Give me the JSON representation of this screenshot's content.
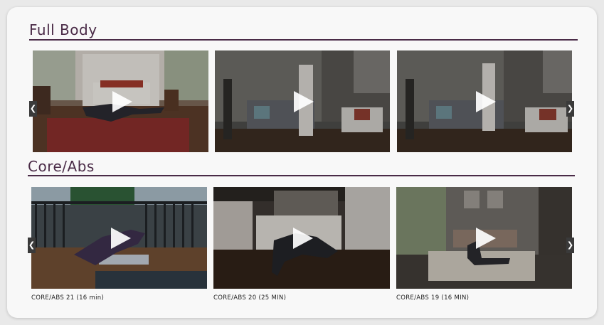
{
  "sections": [
    {
      "title": "Full Body",
      "videos": [
        {
          "caption": ""
        },
        {
          "caption": ""
        },
        {
          "caption": ""
        }
      ]
    },
    {
      "title": "Core/Abs",
      "videos": [
        {
          "caption": "CORE/ABS 21 (16 min)"
        },
        {
          "caption": "CORE/ABS 20 (25 MIN)"
        },
        {
          "caption": "CORE/ABS 19 (16 MIN)"
        }
      ]
    }
  ],
  "controls": {
    "prev_glyph": "❮",
    "next_glyph": "❯"
  },
  "colors": {
    "accent": "#4a2b47",
    "card_bg": "#f8f8f8"
  }
}
